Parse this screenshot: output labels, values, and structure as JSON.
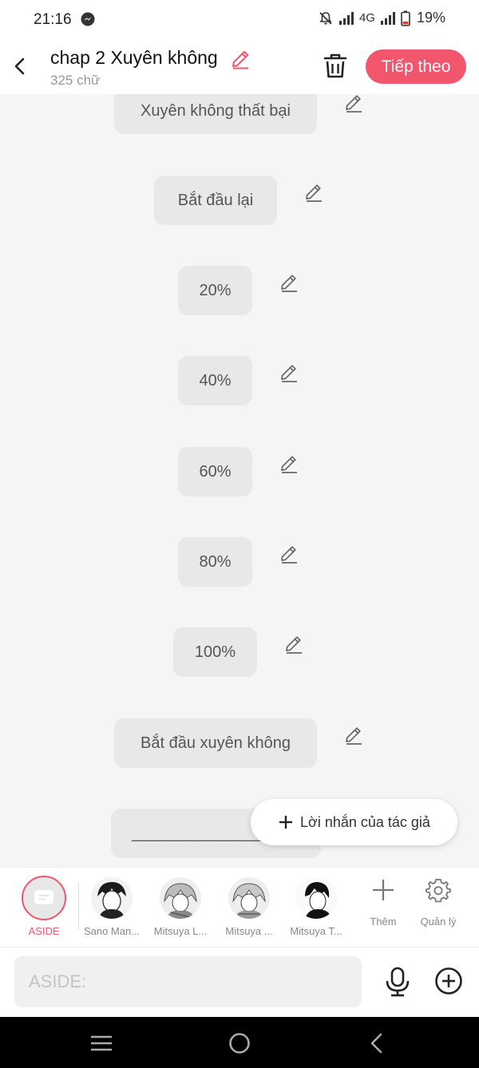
{
  "status_bar": {
    "time": "21:16",
    "network": "4G",
    "battery": "19%"
  },
  "header": {
    "title": "chap 2 Xuyên không",
    "word_count": "325 chữ",
    "next_label": "Tiếp theo"
  },
  "messages": [
    {
      "text": "Xuyên không thất bại"
    },
    {
      "text": "Bắt đầu lại"
    },
    {
      "text": "20%"
    },
    {
      "text": "40%"
    },
    {
      "text": "60%"
    },
    {
      "text": "80%"
    },
    {
      "text": "100%"
    },
    {
      "text": "Bắt đầu xuyên không"
    },
    {
      "text": "_______________"
    }
  ],
  "fab": {
    "label": "Lời nhắn của tác giả"
  },
  "characters": [
    {
      "name": "ASIDE"
    },
    {
      "name": "Sano Man..."
    },
    {
      "name": "Mitsuya L..."
    },
    {
      "name": "Mitsuya ..."
    },
    {
      "name": "Mitsuya T..."
    }
  ],
  "tools": {
    "add_label": "Thêm",
    "manage_label": "Quản lý"
  },
  "composer": {
    "placeholder": "ASIDE:"
  },
  "colors": {
    "accent": "#f2566d",
    "bubble": "#e8e8e8",
    "background": "#f5f5f5"
  }
}
